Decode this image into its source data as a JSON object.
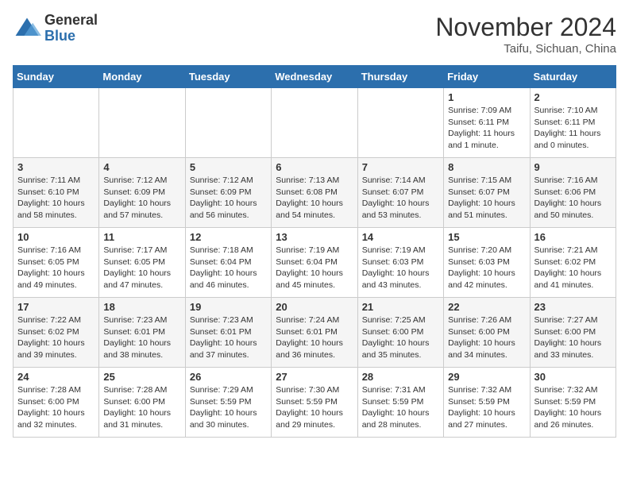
{
  "header": {
    "logo": {
      "general": "General",
      "blue": "Blue"
    },
    "title": "November 2024",
    "location": "Taifu, Sichuan, China"
  },
  "days_of_week": [
    "Sunday",
    "Monday",
    "Tuesday",
    "Wednesday",
    "Thursday",
    "Friday",
    "Saturday"
  ],
  "weeks": [
    [
      {
        "day": "",
        "info": ""
      },
      {
        "day": "",
        "info": ""
      },
      {
        "day": "",
        "info": ""
      },
      {
        "day": "",
        "info": ""
      },
      {
        "day": "",
        "info": ""
      },
      {
        "day": "1",
        "info": "Sunrise: 7:09 AM\nSunset: 6:11 PM\nDaylight: 11 hours and 1 minute."
      },
      {
        "day": "2",
        "info": "Sunrise: 7:10 AM\nSunset: 6:11 PM\nDaylight: 11 hours and 0 minutes."
      }
    ],
    [
      {
        "day": "3",
        "info": "Sunrise: 7:11 AM\nSunset: 6:10 PM\nDaylight: 10 hours and 58 minutes."
      },
      {
        "day": "4",
        "info": "Sunrise: 7:12 AM\nSunset: 6:09 PM\nDaylight: 10 hours and 57 minutes."
      },
      {
        "day": "5",
        "info": "Sunrise: 7:12 AM\nSunset: 6:09 PM\nDaylight: 10 hours and 56 minutes."
      },
      {
        "day": "6",
        "info": "Sunrise: 7:13 AM\nSunset: 6:08 PM\nDaylight: 10 hours and 54 minutes."
      },
      {
        "day": "7",
        "info": "Sunrise: 7:14 AM\nSunset: 6:07 PM\nDaylight: 10 hours and 53 minutes."
      },
      {
        "day": "8",
        "info": "Sunrise: 7:15 AM\nSunset: 6:07 PM\nDaylight: 10 hours and 51 minutes."
      },
      {
        "day": "9",
        "info": "Sunrise: 7:16 AM\nSunset: 6:06 PM\nDaylight: 10 hours and 50 minutes."
      }
    ],
    [
      {
        "day": "10",
        "info": "Sunrise: 7:16 AM\nSunset: 6:05 PM\nDaylight: 10 hours and 49 minutes."
      },
      {
        "day": "11",
        "info": "Sunrise: 7:17 AM\nSunset: 6:05 PM\nDaylight: 10 hours and 47 minutes."
      },
      {
        "day": "12",
        "info": "Sunrise: 7:18 AM\nSunset: 6:04 PM\nDaylight: 10 hours and 46 minutes."
      },
      {
        "day": "13",
        "info": "Sunrise: 7:19 AM\nSunset: 6:04 PM\nDaylight: 10 hours and 45 minutes."
      },
      {
        "day": "14",
        "info": "Sunrise: 7:19 AM\nSunset: 6:03 PM\nDaylight: 10 hours and 43 minutes."
      },
      {
        "day": "15",
        "info": "Sunrise: 7:20 AM\nSunset: 6:03 PM\nDaylight: 10 hours and 42 minutes."
      },
      {
        "day": "16",
        "info": "Sunrise: 7:21 AM\nSunset: 6:02 PM\nDaylight: 10 hours and 41 minutes."
      }
    ],
    [
      {
        "day": "17",
        "info": "Sunrise: 7:22 AM\nSunset: 6:02 PM\nDaylight: 10 hours and 39 minutes."
      },
      {
        "day": "18",
        "info": "Sunrise: 7:23 AM\nSunset: 6:01 PM\nDaylight: 10 hours and 38 minutes."
      },
      {
        "day": "19",
        "info": "Sunrise: 7:23 AM\nSunset: 6:01 PM\nDaylight: 10 hours and 37 minutes."
      },
      {
        "day": "20",
        "info": "Sunrise: 7:24 AM\nSunset: 6:01 PM\nDaylight: 10 hours and 36 minutes."
      },
      {
        "day": "21",
        "info": "Sunrise: 7:25 AM\nSunset: 6:00 PM\nDaylight: 10 hours and 35 minutes."
      },
      {
        "day": "22",
        "info": "Sunrise: 7:26 AM\nSunset: 6:00 PM\nDaylight: 10 hours and 34 minutes."
      },
      {
        "day": "23",
        "info": "Sunrise: 7:27 AM\nSunset: 6:00 PM\nDaylight: 10 hours and 33 minutes."
      }
    ],
    [
      {
        "day": "24",
        "info": "Sunrise: 7:28 AM\nSunset: 6:00 PM\nDaylight: 10 hours and 32 minutes."
      },
      {
        "day": "25",
        "info": "Sunrise: 7:28 AM\nSunset: 6:00 PM\nDaylight: 10 hours and 31 minutes."
      },
      {
        "day": "26",
        "info": "Sunrise: 7:29 AM\nSunset: 5:59 PM\nDaylight: 10 hours and 30 minutes."
      },
      {
        "day": "27",
        "info": "Sunrise: 7:30 AM\nSunset: 5:59 PM\nDaylight: 10 hours and 29 minutes."
      },
      {
        "day": "28",
        "info": "Sunrise: 7:31 AM\nSunset: 5:59 PM\nDaylight: 10 hours and 28 minutes."
      },
      {
        "day": "29",
        "info": "Sunrise: 7:32 AM\nSunset: 5:59 PM\nDaylight: 10 hours and 27 minutes."
      },
      {
        "day": "30",
        "info": "Sunrise: 7:32 AM\nSunset: 5:59 PM\nDaylight: 10 hours and 26 minutes."
      }
    ]
  ]
}
